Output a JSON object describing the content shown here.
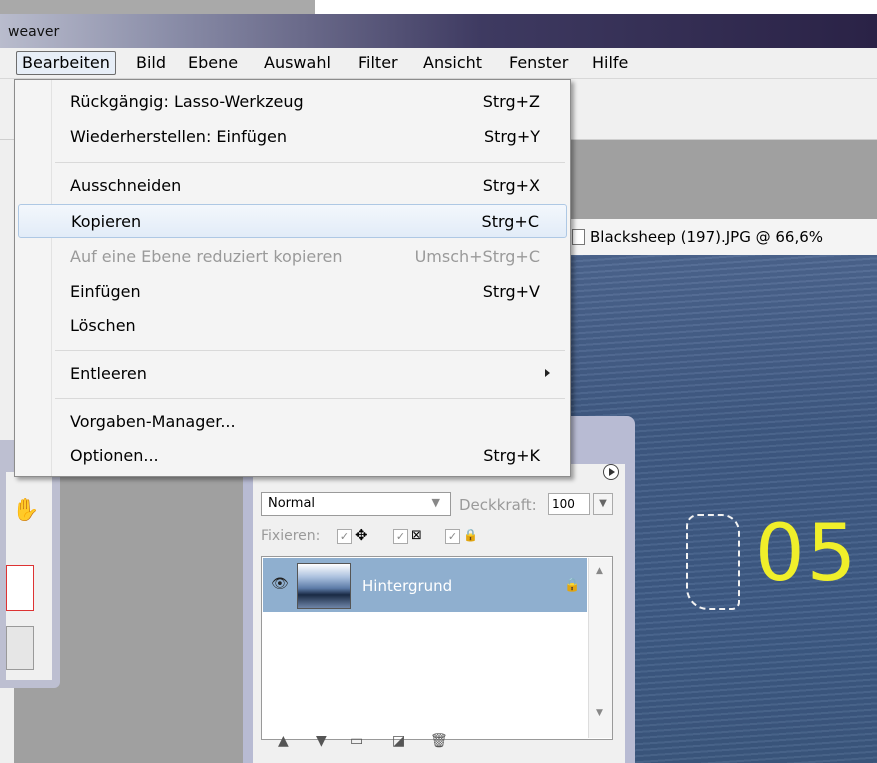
{
  "window": {
    "title": "weaver"
  },
  "menubar": {
    "items": [
      {
        "label": "Bearbeiten",
        "active": true
      },
      {
        "label": "Bild"
      },
      {
        "label": "Ebene"
      },
      {
        "label": "Auswahl"
      },
      {
        "label": "Filter"
      },
      {
        "label": "Ansicht"
      },
      {
        "label": "Fenster"
      },
      {
        "label": "Hilfe"
      }
    ]
  },
  "edit_menu": {
    "items": [
      {
        "label": "Rückgängig: Lasso-Werkzeug",
        "shortcut": "Strg+Z"
      },
      {
        "label": "Wiederherstellen: Einfügen",
        "shortcut": "Strg+Y"
      },
      {
        "label": "Ausschneiden",
        "shortcut": "Strg+X"
      },
      {
        "label": "Kopieren",
        "shortcut": "Strg+C",
        "highlighted": true
      },
      {
        "label": "Auf eine Ebene reduziert kopieren",
        "shortcut": "Umsch+Strg+C",
        "disabled": true
      },
      {
        "label": "Einfügen",
        "shortcut": "Strg+V"
      },
      {
        "label": "Löschen",
        "shortcut": ""
      },
      {
        "label": "Entleeren",
        "shortcut": "",
        "submenu": true
      },
      {
        "label": "Vorgaben-Manager...",
        "shortcut": ""
      },
      {
        "label": "Optionen...",
        "shortcut": "Strg+K"
      }
    ]
  },
  "document": {
    "tab_title": "Blacksheep (197).JPG @ 66,6%",
    "overlay_text": "05",
    "overlay_color": "#f0ef2a"
  },
  "layers_panel": {
    "blend_mode": "Normal",
    "opacity_label": "Deckkraft:",
    "opacity_value": "100",
    "lock_label": "Fixieren:",
    "layer_name": "Hintergrund"
  },
  "colors": {
    "menu_highlight": "#e2ecf8",
    "layer_selected": "#8fafcf"
  }
}
